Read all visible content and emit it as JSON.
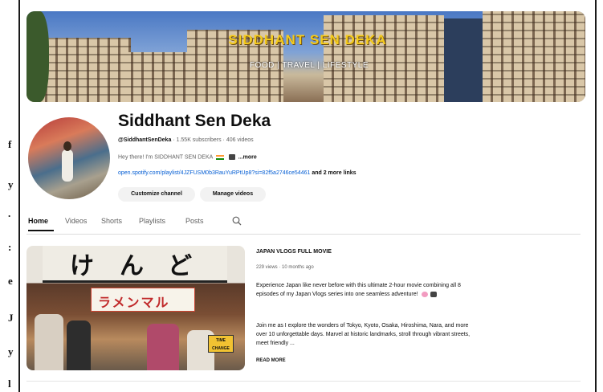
{
  "page_fragment": {
    "left_letters": [
      "f",
      "y",
      ".",
      ":",
      "e",
      "J",
      "y",
      "l"
    ]
  },
  "banner": {
    "title": "SIDDHANT SEN DEKA",
    "subtitle": "FOOD | TRAVEL | LIFESTYLE"
  },
  "channel": {
    "name": "Siddhant Sen Deka",
    "handle": "@SiddhantSenDeka",
    "stats": "· 1.55K subscribers · 406 videos",
    "bio": "Hey there! I'm SIDDHANT SEN DEKA",
    "bio_more": "...more",
    "link_url": "open.spotify.com/playlist/4JZFUSM0b3RauYuRPtUp8?si=82f5a2746ce54461",
    "link_extra": "and 2 more links",
    "customize_label": "Customize channel",
    "manage_label": "Manage videos"
  },
  "tabs": [
    {
      "label": "Home",
      "active": true
    },
    {
      "label": "Videos",
      "active": false
    },
    {
      "label": "Shorts",
      "active": false
    },
    {
      "label": "Playlists",
      "active": false
    },
    {
      "label": "Posts",
      "active": false
    }
  ],
  "featured": {
    "sign_text": [
      "け",
      "ん",
      "ど"
    ],
    "noren_text": "ラメンマル",
    "badge_text": "TIME CHANGE",
    "title": "JAPAN VLOGS FULL MOVIE",
    "meta": "229 views · 10 months ago",
    "desc1": "Experience Japan like never before with this ultimate 2-hour movie combining all 8 episodes of my Japan Vlogs series into one seamless adventure!",
    "desc2": "Join me as I explore the wonders of Tokyo, Kyoto, Osaka, Hiroshima, Nara, and more over 10 unforgettable days. Marvel at historic landmarks, stroll through vibrant streets, meet friendly ...",
    "read_more": "READ MORE"
  },
  "colors": {
    "banner_title": "#f5cb1c",
    "link": "#065fd4",
    "button_bg": "#f2f2f2"
  }
}
